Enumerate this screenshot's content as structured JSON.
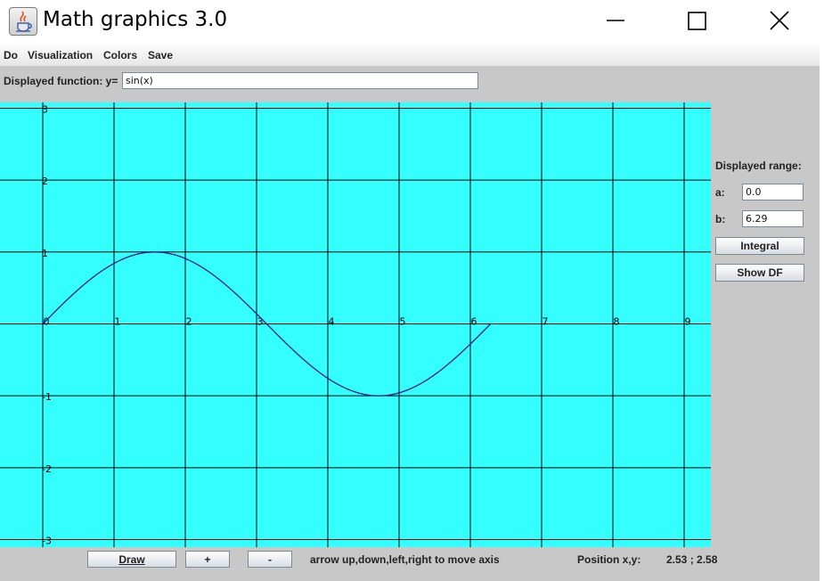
{
  "titlebar": {
    "title": "Math graphics 3.0",
    "icon": "java-app-icon"
  },
  "menu": {
    "items": [
      "Do",
      "Visualization",
      "Colors",
      "Save"
    ]
  },
  "function": {
    "label": "Displayed function: y=",
    "value": "sin(x)"
  },
  "range": {
    "label": "Displayed range:",
    "a_label": "a:",
    "a_value": "0.0",
    "b_label": "b:",
    "b_value": "6.29"
  },
  "buttons": {
    "integral": "Integral",
    "show_df": "Show DF",
    "draw": "Draw",
    "plus": "+",
    "minus": "-"
  },
  "status": {
    "hint": "arrow up,down,left,right to move axis",
    "position_label": "Position x,y:",
    "position_value": "2.53 ; 2.58"
  },
  "colors": {
    "plot_background": "#33ffff",
    "grid": "#000000",
    "curve": "#1a1a8c"
  },
  "chart_data": {
    "type": "line",
    "function": "sin(x)",
    "series": [
      {
        "expression": "sin(x)",
        "domain": [
          0.0,
          6.29
        ]
      }
    ],
    "x_ticks": [
      0,
      1,
      2,
      3,
      4,
      5,
      6,
      7,
      8,
      9
    ],
    "y_ticks": [
      3,
      2,
      1,
      0,
      -1,
      -2,
      -3
    ],
    "xlim": [
      -0.6,
      9.375
    ],
    "ylim": [
      -3.105,
      3.08
    ],
    "grid": true
  }
}
